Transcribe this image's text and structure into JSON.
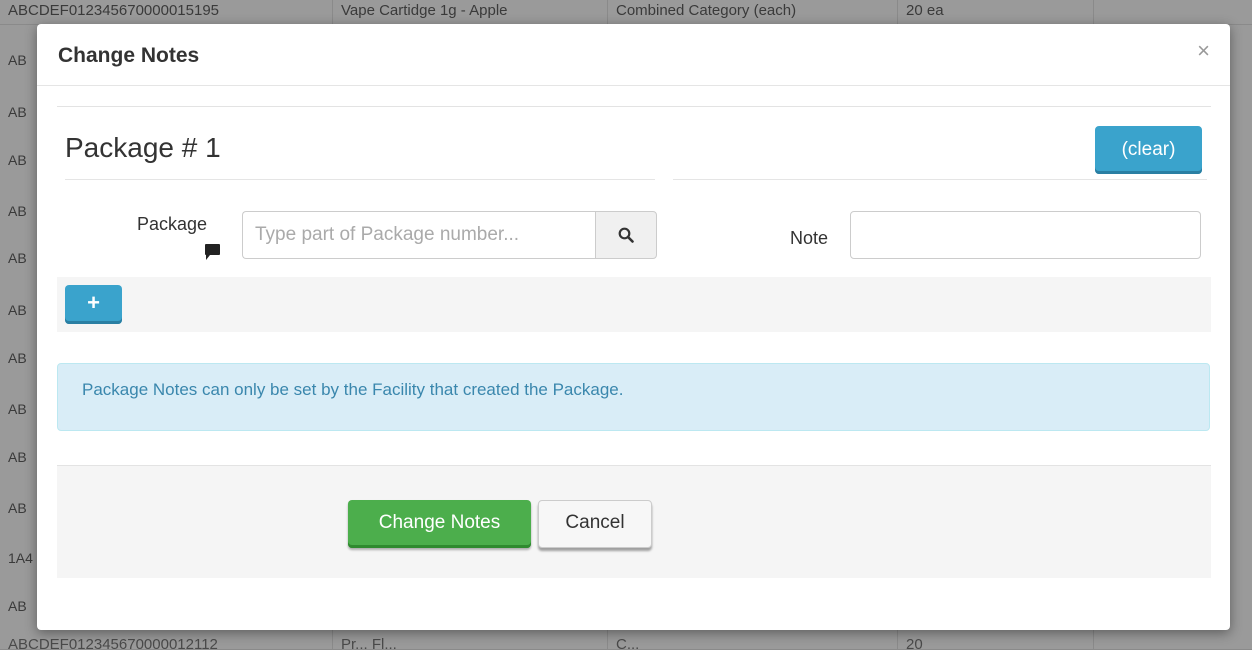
{
  "background": {
    "top_row": [
      "ABCDEF012345670000015195",
      "Vape Cartidge 1g - Apple",
      "Combined Category (each)",
      "20 ea"
    ],
    "left_fragments": [
      "AB",
      "AB",
      "AB",
      "AB",
      "AB",
      "AB",
      "AB",
      "AB",
      "AB",
      "AB",
      "1A4",
      "AB"
    ],
    "bottom_row": [
      "ABCDEF012345670000012112",
      "Pr... Fl...",
      "C...",
      "20"
    ]
  },
  "modal": {
    "title": "Change Notes",
    "close_label": "×",
    "package_heading": "Package # 1",
    "clear_label": "(clear)",
    "package_label": "Package",
    "package_placeholder": "Type part of Package number...",
    "note_label": "Note",
    "note_value": "",
    "add_label": "+",
    "info_message": "Package Notes can only be set by the Facility that created the Package.",
    "submit_label": "Change Notes",
    "cancel_label": "Cancel"
  },
  "colors": {
    "info_bg": "#d9edf7",
    "info_text": "#3a87ad",
    "primary_blue": "#3aa3cc",
    "success_green": "#4cae4c"
  },
  "icons": {
    "search": "magnifier",
    "note": "speech-bubble",
    "close": "x-mark",
    "add": "plus"
  }
}
